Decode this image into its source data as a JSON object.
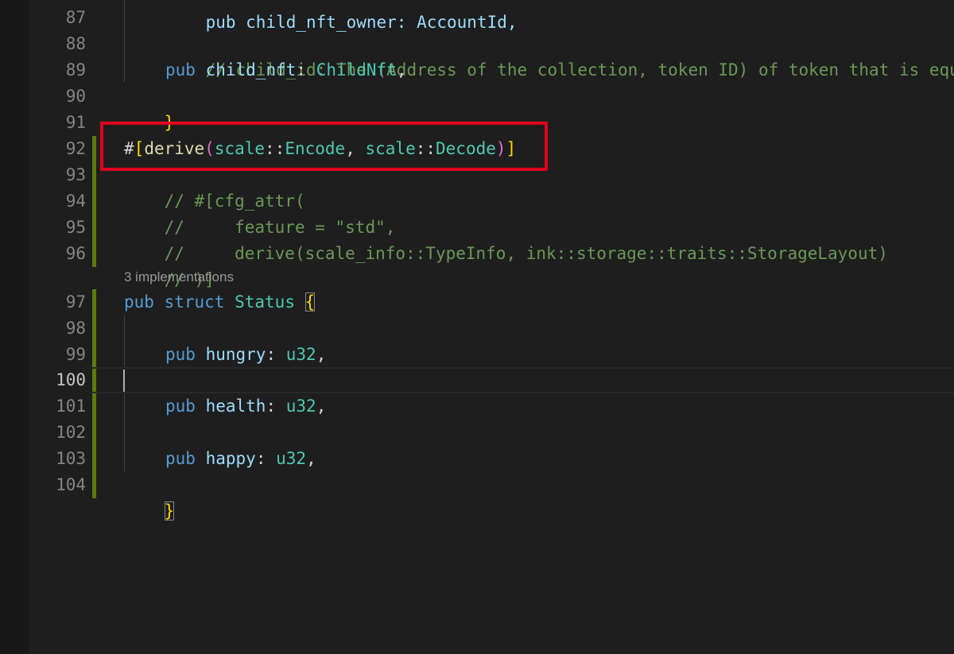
{
  "editor": {
    "current_line": "100",
    "codelens": "3 implementations",
    "line_numbers": [
      "87",
      "88",
      "89",
      "90",
      "91",
      "92",
      "93",
      "94",
      "95",
      "96",
      "97",
      "98",
      "99",
      "100",
      "101",
      "102",
      "103",
      "104"
    ],
    "lines": {
      "l87": "pub child_nft_owner: AccountId,",
      "l88": "// child_id: The (Address of the collection, token ID) of token that is equ",
      "l89": {
        "kw": "pub",
        "field": "child_nft",
        "colon": ":",
        "type": "ChildNft",
        "comma": ","
      },
      "l90": "}",
      "l92": {
        "hash": "#",
        "lb": "[",
        "fn": "derive",
        "lp": "(",
        "a1": "scale",
        "sep1": "::",
        "t1": "Encode",
        "comma": ", ",
        "a2": "scale",
        "sep2": "::",
        "t2": "Decode",
        "rp": ")",
        "rb": "]"
      },
      "l93": "// #[cfg_attr(",
      "l94": "//     feature = \"std\",",
      "l95": "//     derive(scale_info::TypeInfo, ink::storage::traits::StorageLayout)",
      "l96": "// )]",
      "l97": {
        "kw1": "pub",
        "kw2": "struct",
        "type": "Status",
        "brace": "{"
      },
      "l99": {
        "kw": "pub",
        "field": "hungry",
        "colon": ":",
        "type": "u32",
        "comma": ","
      },
      "l101": {
        "kw": "pub",
        "field": "health",
        "colon": ":",
        "type": "u32",
        "comma": ","
      },
      "l103": {
        "kw": "pub",
        "field": "happy",
        "colon": ":",
        "type": "u32",
        "comma": ","
      },
      "l104": "}"
    }
  },
  "colors": {
    "background": "#1e1e1e",
    "keyword": "#569cd6",
    "field": "#9cdcfe",
    "type": "#4ec9b0",
    "function": "#dcdcaa",
    "comment": "#6a9955",
    "bracket_gold": "#ffd700",
    "bracket_purple": "#da70d6",
    "git_modified": "#587c0c",
    "annotation_box": "#e0001b"
  }
}
